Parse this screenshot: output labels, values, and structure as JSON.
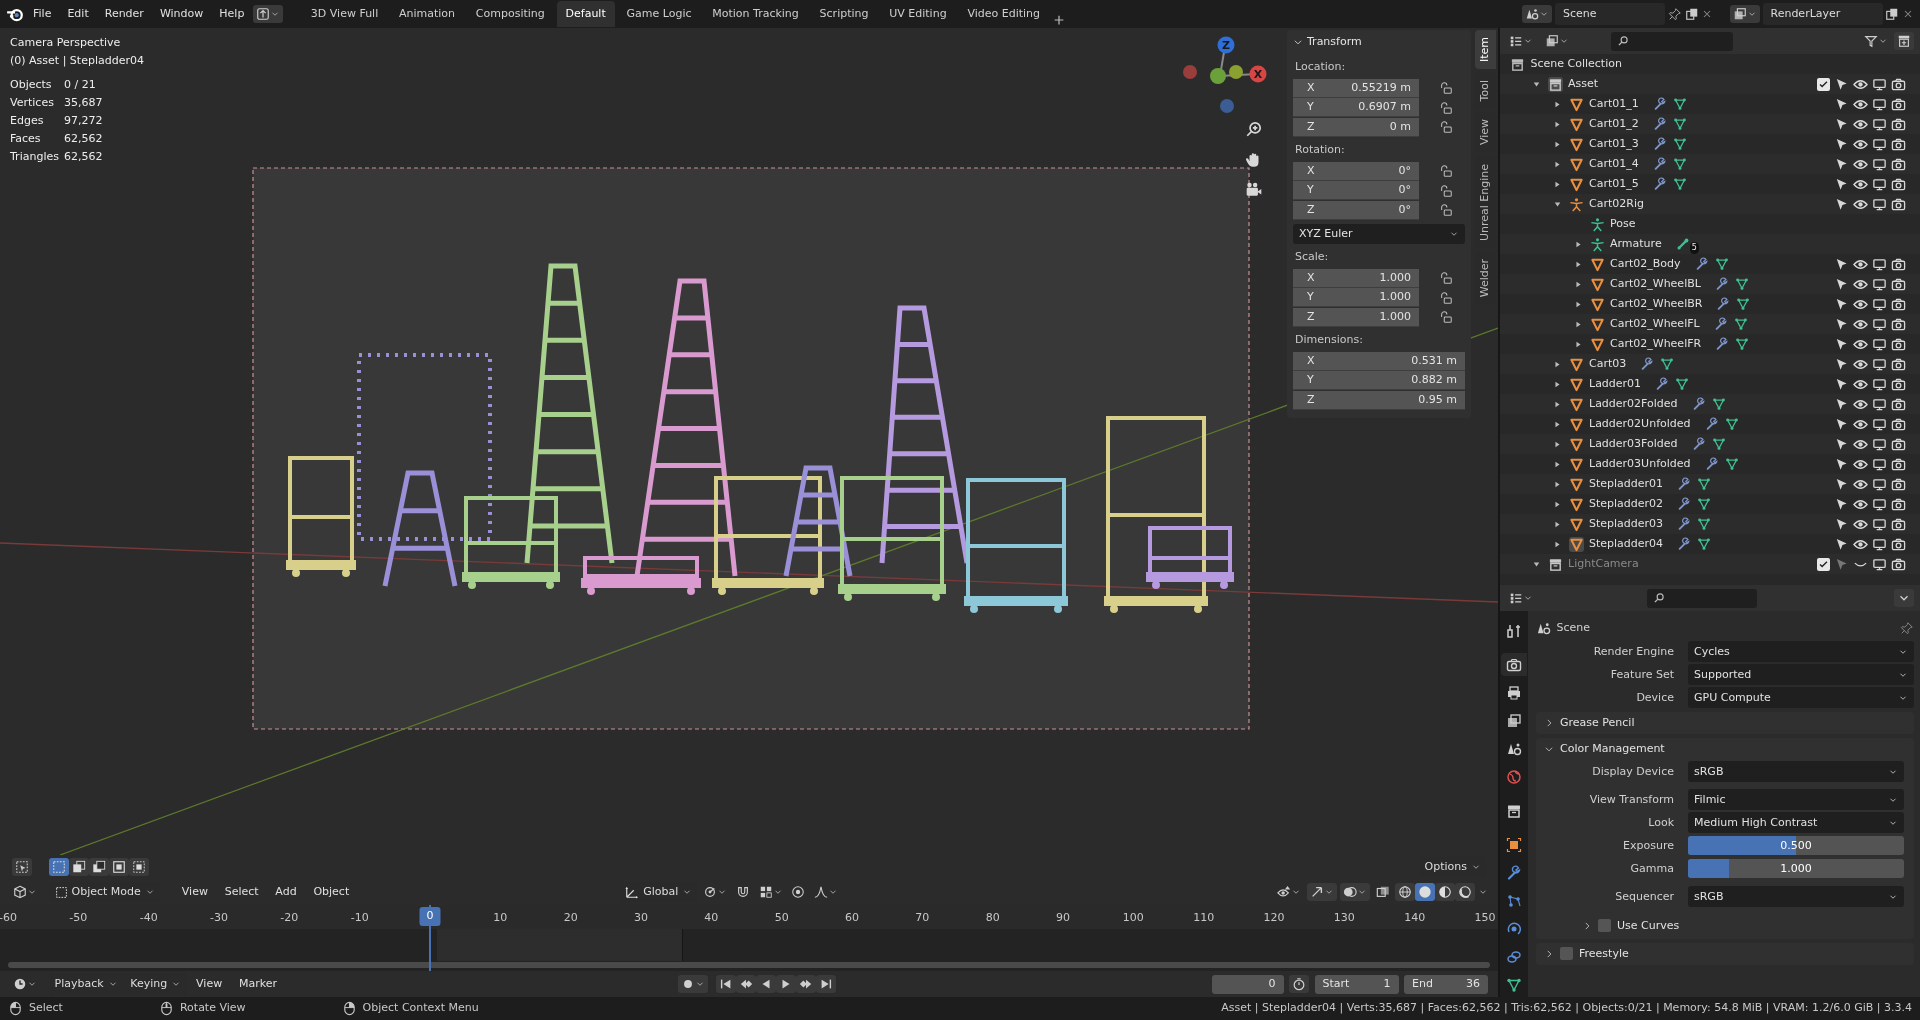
{
  "top_bar": {
    "menus": [
      "File",
      "Edit",
      "Render",
      "Window",
      "Help"
    ],
    "workspaces": [
      {
        "label": "3D View Full",
        "selected": false
      },
      {
        "label": "Animation",
        "selected": false
      },
      {
        "label": "Compositing",
        "selected": false
      },
      {
        "label": "Default",
        "selected": true
      },
      {
        "label": "Game Logic",
        "selected": false
      },
      {
        "label": "Motion Tracking",
        "selected": false
      },
      {
        "label": "Scripting",
        "selected": false
      },
      {
        "label": "UV Editing",
        "selected": false
      },
      {
        "label": "Video Editing",
        "selected": false
      }
    ],
    "scene": "Scene",
    "view_layer": "RenderLayer"
  },
  "viewport": {
    "view_name": "Camera Perspective",
    "context": "(0) Asset | Stepladder04",
    "stats": [
      {
        "label": "Objects",
        "value": "0 / 21"
      },
      {
        "label": "Vertices",
        "value": "35,687"
      },
      {
        "label": "Edges",
        "value": "97,272"
      },
      {
        "label": "Faces",
        "value": "62,562"
      },
      {
        "label": "Triangles",
        "value": "62,562"
      }
    ],
    "gizmo_labels": [
      "Z",
      "X"
    ],
    "options": "Options",
    "header": {
      "mode": "Object Mode",
      "menus": [
        "View",
        "Select",
        "Add",
        "Object"
      ],
      "orientation": "Global"
    },
    "sidebar_tabs": [
      {
        "label": "Item",
        "selected": true
      },
      {
        "label": "Tool",
        "selected": false
      },
      {
        "label": "View",
        "selected": false
      },
      {
        "label": "Unreal Engine",
        "selected": false
      },
      {
        "label": "Welder",
        "selected": false
      }
    ],
    "transform": {
      "title": "Transform",
      "expanded": true,
      "groups": [
        {
          "label": "Location:",
          "fields": [
            {
              "axis": "X",
              "value": "0.55219 m",
              "locked": false
            },
            {
              "axis": "Y",
              "value": "0.6907 m",
              "locked": false
            },
            {
              "axis": "Z",
              "value": "0 m",
              "locked": false
            }
          ]
        },
        {
          "label": "Rotation:",
          "fields": [
            {
              "axis": "X",
              "value": "0°",
              "locked": false
            },
            {
              "axis": "Y",
              "value": "0°",
              "locked": false
            },
            {
              "axis": "Z",
              "value": "0°",
              "locked": false
            }
          ],
          "mode": "XYZ Euler"
        },
        {
          "label": "Scale:",
          "fields": [
            {
              "axis": "X",
              "value": "1.000",
              "locked": false
            },
            {
              "axis": "Y",
              "value": "1.000",
              "locked": false
            },
            {
              "axis": "Z",
              "value": "1.000",
              "locked": false
            }
          ]
        },
        {
          "label": "Dimensions:",
          "fields": [
            {
              "axis": "X",
              "value": "0.531 m"
            },
            {
              "axis": "Y",
              "value": "0.882 m"
            },
            {
              "axis": "Z",
              "value": "0.95 m"
            }
          ]
        }
      ]
    }
  },
  "outliner": {
    "root": "Scene Collection",
    "items": [
      {
        "name": "Asset",
        "kind": "collection",
        "expanded": true,
        "active": true,
        "checked": true,
        "visible": true,
        "children": [
          {
            "name": "Cart01_1",
            "kind": "mesh",
            "expanded": false,
            "active": false,
            "visible": true
          },
          {
            "name": "Cart01_2",
            "kind": "mesh",
            "expanded": false,
            "active": false,
            "visible": true
          },
          {
            "name": "Cart01_3",
            "kind": "mesh",
            "expanded": false,
            "active": false,
            "visible": true
          },
          {
            "name": "Cart01_4",
            "kind": "mesh",
            "expanded": false,
            "active": false,
            "visible": true
          },
          {
            "name": "Cart01_5",
            "kind": "mesh",
            "expanded": false,
            "active": false,
            "visible": true
          },
          {
            "name": "Cart02Rig",
            "kind": "armature",
            "expanded": true,
            "active": false,
            "visible": true,
            "children": [
              {
                "name": "Pose",
                "kind": "pose"
              },
              {
                "name": "Armature",
                "kind": "armature_data",
                "expanded": false,
                "bones": "5"
              },
              {
                "name": "Cart02_Body",
                "kind": "mesh",
                "expanded": false,
                "active": false,
                "visible": true
              },
              {
                "name": "Cart02_WheelBL",
                "kind": "mesh",
                "expanded": false,
                "active": false,
                "visible": true
              },
              {
                "name": "Cart02_WheelBR",
                "kind": "mesh",
                "expanded": false,
                "active": false,
                "visible": true
              },
              {
                "name": "Cart02_WheelFL",
                "kind": "mesh",
                "expanded": false,
                "active": false,
                "visible": true
              },
              {
                "name": "Cart02_WheelFR",
                "kind": "mesh",
                "expanded": false,
                "active": false,
                "visible": true
              }
            ]
          },
          {
            "name": "Cart03",
            "kind": "mesh",
            "expanded": false,
            "active": false,
            "visible": true
          },
          {
            "name": "Ladder01",
            "kind": "mesh",
            "expanded": false,
            "active": false,
            "visible": true
          },
          {
            "name": "Ladder02Folded",
            "kind": "mesh",
            "expanded": false,
            "active": false,
            "visible": true
          },
          {
            "name": "Ladder02Unfolded",
            "kind": "mesh",
            "expanded": false,
            "active": false,
            "visible": true
          },
          {
            "name": "Ladder03Folded",
            "kind": "mesh",
            "expanded": false,
            "active": false,
            "visible": true
          },
          {
            "name": "Ladder03Unfolded",
            "kind": "mesh",
            "expanded": false,
            "active": false,
            "visible": true
          },
          {
            "name": "Stepladder01",
            "kind": "mesh",
            "expanded": false,
            "active": false,
            "visible": true
          },
          {
            "name": "Stepladder02",
            "kind": "mesh",
            "expanded": false,
            "active": false,
            "visible": true
          },
          {
            "name": "Stepladder03",
            "kind": "mesh",
            "expanded": false,
            "active": false,
            "visible": true
          },
          {
            "name": "Stepladder04",
            "kind": "mesh",
            "expanded": false,
            "active": true,
            "visible": true
          }
        ]
      },
      {
        "name": "LightCamera",
        "kind": "collection",
        "expanded": true,
        "active": false,
        "checked": true,
        "visible": false
      }
    ]
  },
  "properties": {
    "tabs": [
      {
        "kind": "tool",
        "selected": false
      },
      {
        "kind": "render",
        "selected": true
      },
      {
        "kind": "output",
        "selected": false
      },
      {
        "kind": "view_layer",
        "selected": false
      },
      {
        "kind": "scene",
        "selected": false
      },
      {
        "kind": "world",
        "selected": false
      },
      {
        "kind": "collection",
        "selected": false
      },
      {
        "kind": "object",
        "selected": false
      },
      {
        "kind": "modifiers",
        "selected": false
      },
      {
        "kind": "particles",
        "selected": false
      },
      {
        "kind": "physics",
        "selected": false
      },
      {
        "kind": "constraints",
        "selected": false
      },
      {
        "kind": "data",
        "selected": false
      }
    ],
    "context": "Scene",
    "fields": [
      {
        "label": "Render Engine",
        "value": "Cycles"
      },
      {
        "label": "Feature Set",
        "value": "Supported"
      },
      {
        "label": "Device",
        "value": "GPU Compute"
      }
    ],
    "panels": [
      {
        "title": "Grease Pencil",
        "expanded": false
      },
      {
        "title": "Color Management",
        "expanded": true,
        "rows": [
          {
            "kind": "dropdown",
            "label": "Display Device",
            "value": "sRGB"
          },
          {
            "kind": "dropdown",
            "label": "View Transform",
            "value": "Filmic"
          },
          {
            "kind": "dropdown",
            "label": "Look",
            "value": "Medium High Contrast"
          },
          {
            "kind": "slider",
            "label": "Exposure",
            "value": "0.500",
            "level": 0.5
          },
          {
            "kind": "slider",
            "label": "Gamma",
            "value": "1.000",
            "level": 0.19
          },
          {
            "kind": "dropdown",
            "label": "Sequencer",
            "value": "sRGB"
          },
          {
            "kind": "subpanel",
            "label": "Use Curves",
            "expanded": false,
            "checked": false
          }
        ]
      },
      {
        "title": "Freestyle",
        "expanded": false,
        "checked": false
      }
    ]
  },
  "timeline": {
    "menus": [
      "Playback",
      "Keying",
      "View",
      "Marker"
    ],
    "ticks": [
      "-60",
      "-50",
      "-40",
      "-30",
      "-20",
      "-10",
      "10",
      "20",
      "30",
      "40",
      "50",
      "60",
      "70",
      "80",
      "90",
      "100",
      "110",
      "120",
      "130",
      "140",
      "150"
    ],
    "current_frame": "0",
    "frame_field": "0",
    "start_label": "Start",
    "start": "1",
    "end_label": "End",
    "end": "36"
  },
  "status_bar": {
    "hints": [
      {
        "kind": "left",
        "label": "Select"
      },
      {
        "kind": "middle",
        "label": "Rotate View"
      },
      {
        "kind": "right",
        "label": "Object Context Menu"
      }
    ],
    "info": "Asset | Stepladder04 | Verts:35,687 | Faces:62,562 | Tris:62,562 | Objects:0/21 | Memory: 54.8 MiB | VRAM: 1.2/6.0 GiB | 3.3.4"
  }
}
